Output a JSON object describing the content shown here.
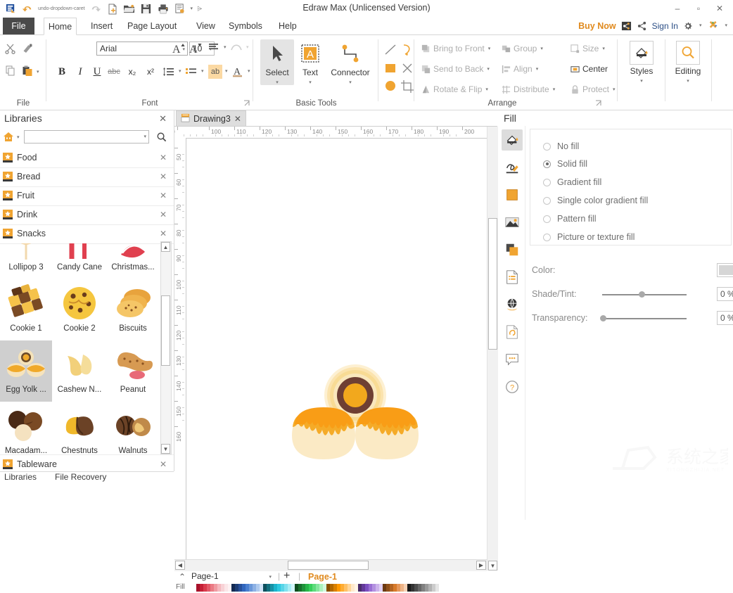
{
  "app": {
    "title": "Edraw Max (Unlicensed Version)",
    "quick_access": [
      "edraw-logo-icon",
      "undo-icon",
      "undo-dropdown-caret",
      "redo-icon",
      "new-icon",
      "open-icon",
      "save-icon",
      "print-icon",
      "print-preview-icon",
      "print-dropdown-caret",
      "qat-customize-caret"
    ],
    "window_buttons": {
      "minimize": "–",
      "maximize": "▫",
      "close": "✕"
    }
  },
  "menu": {
    "file_label": "File",
    "tabs": [
      "Home",
      "Insert",
      "Page Layout",
      "View",
      "Symbols",
      "Help"
    ],
    "active_tab": "Home"
  },
  "account": {
    "buy_now": "Buy Now",
    "share_icon": "share-box-icon",
    "social_icon": "share-nodes-icon",
    "sign_in": "Sign In",
    "settings_icon": "gear-icon",
    "settings_caret": "▾",
    "apps_icon": "apps-cross-icon",
    "help_caret": "▾"
  },
  "ribbon": {
    "groups": [
      {
        "name": "File",
        "label": "File"
      },
      {
        "name": "Font",
        "label": "Font"
      },
      {
        "name": "Basic Tools",
        "label": "Basic Tools"
      },
      {
        "name": "Arrange",
        "label": "Arrange"
      }
    ],
    "file_group": {
      "cut": "cut-scissors-icon",
      "format_painter": "format-painter-icon",
      "copy": "copy-icon",
      "paste": "paste-icon",
      "paste_caret": "▾"
    },
    "font_group": {
      "font_name": "Arial",
      "font_size": "10",
      "grow_font": "grow-font-icon",
      "shrink_font": "shrink-font-icon",
      "align_text": "align-text-icon",
      "curve_text": "curve-text-icon",
      "bold": "B",
      "italic": "I",
      "underline": "U",
      "strikethrough": "abc",
      "subscript": "x₂",
      "superscript": "x²",
      "line_spacing": "line-spacing-icon",
      "bullets": "bullet-list-icon",
      "highlight": "ab",
      "font_color": "A"
    },
    "basic_tools": {
      "select": "Select",
      "text": "Text",
      "connector": "Connector",
      "caret": "▾",
      "line": "line-tool-icon",
      "arc": "arc-tool-icon",
      "rectangle": "rectangle-tool-icon",
      "cross": "x-close-tool-icon",
      "ellipse": "ellipse-tool-icon",
      "crop": "crop-tool-icon"
    },
    "arrange": {
      "bring_to_front": "Bring to Front",
      "send_to_back": "Send to Back",
      "rotate_flip": "Rotate & Flip",
      "group": "Group",
      "align": "Align",
      "distribute": "Distribute",
      "size": "Size",
      "center": "Center",
      "protect": "Protect",
      "caret": "▾"
    },
    "styles": {
      "label": "Styles",
      "caret": "▾",
      "icon": "paint-bucket-icon"
    },
    "editing": {
      "label": "Editing",
      "caret": "▾",
      "icon": "magnifier-icon"
    }
  },
  "libraries": {
    "title": "Libraries",
    "close": "✕",
    "home_icon": "home-icon",
    "home_caret": "▾",
    "search_placeholder": "",
    "search_value": "",
    "search_caret": "▾",
    "search_icon": "search-icon",
    "categories": [
      {
        "label": "Food",
        "close": "✕"
      },
      {
        "label": "Bread",
        "close": "✕"
      },
      {
        "label": "Fruit",
        "close": "✕"
      },
      {
        "label": "Drink",
        "close": "✕"
      },
      {
        "label": "Snacks",
        "close": "✕"
      }
    ],
    "footer_category": {
      "label": "Tableware",
      "close": "✕"
    },
    "shapes": [
      {
        "label": "Lollipop 3",
        "art": "lollipop",
        "selected": false
      },
      {
        "label": "Candy Cane",
        "art": "candycane",
        "selected": false
      },
      {
        "label": "Christmas...",
        "art": "christmas",
        "selected": false
      },
      {
        "label": "Cookie 1",
        "art": "cookie1",
        "selected": false
      },
      {
        "label": "Cookie 2",
        "art": "cookie2",
        "selected": false
      },
      {
        "label": "Biscuits",
        "art": "biscuits",
        "selected": false
      },
      {
        "label": "Egg Yolk ...",
        "art": "eggyolk",
        "selected": true
      },
      {
        "label": "Cashew N...",
        "art": "cashew",
        "selected": false
      },
      {
        "label": "Peanut",
        "art": "peanut",
        "selected": false
      },
      {
        "label": "Macadam...",
        "art": "macadamia",
        "selected": false
      },
      {
        "label": "Chestnuts",
        "art": "chestnuts",
        "selected": false
      },
      {
        "label": "Walnuts",
        "art": "walnuts",
        "selected": false
      }
    ],
    "scroll_up": "▲",
    "scroll_down": "▼",
    "bottom_tabs": [
      "Libraries",
      "File Recovery"
    ]
  },
  "canvas": {
    "document_tab": "Drawing3",
    "document_tab_close": "✕",
    "document_tab_icon": "document-icon",
    "h_ruler_labels": [
      "100",
      "110",
      "120",
      "130",
      "140",
      "150",
      "160",
      "170",
      "180",
      "190",
      "200"
    ],
    "v_ruler_labels": [
      "50",
      "60",
      "70",
      "80",
      "90",
      "100",
      "110",
      "120",
      "130",
      "140",
      "150",
      "160"
    ],
    "shape_on_canvas": "Egg Yolk Pastry",
    "scroll_left": "◀",
    "scroll_right": "▶",
    "scroll_up": "▲",
    "scroll_down": "▼"
  },
  "pagebar": {
    "collapse_caret": "ⱏ",
    "page_selector_value": "Page-1",
    "page_selector_caret": "▾",
    "add_page": "+",
    "active_page_tab": "Page-1",
    "fill_label": "Fill"
  },
  "fill_panel": {
    "title": "Fill",
    "side_icons": [
      {
        "name": "fill-icon",
        "selected": true
      },
      {
        "name": "line-pen-icon",
        "selected": false
      },
      {
        "name": "shadow-square-icon",
        "selected": false
      },
      {
        "name": "picture-icon",
        "selected": false
      },
      {
        "name": "layer-icon",
        "selected": false
      },
      {
        "name": "document-properties-icon",
        "selected": false
      },
      {
        "name": "hyperlink-globe-icon",
        "selected": false
      },
      {
        "name": "attachment-icon",
        "selected": false
      },
      {
        "name": "comment-icon",
        "selected": false
      },
      {
        "name": "help-icon",
        "selected": false
      }
    ],
    "options": [
      {
        "label": "No fill",
        "selected": false
      },
      {
        "label": "Solid fill",
        "selected": true
      },
      {
        "label": "Gradient fill",
        "selected": false
      },
      {
        "label": "Single color gradient fill",
        "selected": false
      },
      {
        "label": "Pattern fill",
        "selected": false
      },
      {
        "label": "Picture or texture fill",
        "selected": false
      }
    ],
    "color_label": "Color:",
    "color_value": "#d6d6d6",
    "color_caret": "▾",
    "shade_label": "Shade/Tint:",
    "shade_value": "0 %",
    "shade_percent": 50,
    "transparency_label": "Transparency:",
    "transparency_value": "0 %",
    "transparency_percent": 0
  },
  "colors": {
    "accent_orange": "#f5a623",
    "brand_orange": "#e08a1e",
    "ribbon_bg": "#ffffff",
    "file_tab_bg": "#4a4a4a",
    "selected_shape_bg": "#cfcfcf",
    "palette_row": [
      "#ffffff",
      "#a8112a",
      "#c41f36",
      "#d93a4c",
      "#e25a68",
      "#eb7b85",
      "#f09ba2",
      "#f5b9bf",
      "#f8d2d6",
      "#fbe6e8",
      "#fdf2f3",
      "#132a52",
      "#1d3d75",
      "#27509a",
      "#3166bd",
      "#4a7fd0",
      "#6b98da",
      "#8db1e4",
      "#afcaee",
      "#d0e2f7",
      "#0d4f5c",
      "#12707f",
      "#1792a6",
      "#1cb4cc",
      "#2fc9e0",
      "#58d5e8",
      "#81e1ef",
      "#aaedf5",
      "#d3f6fa",
      "#0f4d1e",
      "#17702c",
      "#1f933b",
      "#27b649",
      "#37cf5c",
      "#5ddb7c",
      "#84e79d",
      "#abf2bd",
      "#d2f8de",
      "#8a5000",
      "#b36800",
      "#d98000",
      "#ff9900",
      "#ffad33",
      "#ffc166",
      "#ffd699",
      "#ffeacc",
      "#fff5e6",
      "#4a2d6b",
      "#63399a",
      "#7c4fc0",
      "#9a6fd4",
      "#b391e0",
      "#ccb3eb",
      "#e0d1f4",
      "#6b3a12",
      "#8f4f19",
      "#b36421",
      "#d77a2a",
      "#e59759",
      "#eeb487",
      "#f6d2b5",
      "#1a1a1a",
      "#333333",
      "#4d4d4d",
      "#666666",
      "#808080",
      "#999999",
      "#b3b3b3",
      "#cccccc",
      "#e6e6e6"
    ]
  },
  "watermark": {
    "text": "系统之家"
  }
}
